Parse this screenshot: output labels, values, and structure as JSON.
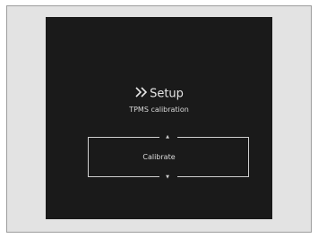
{
  "display": {
    "title": "Setup",
    "title_icon": "double-chevron-right-icon",
    "subtitle": "TPMS calibration",
    "option_label": "Calibrate",
    "up_arrow": "▲",
    "down_arrow": "▼"
  }
}
